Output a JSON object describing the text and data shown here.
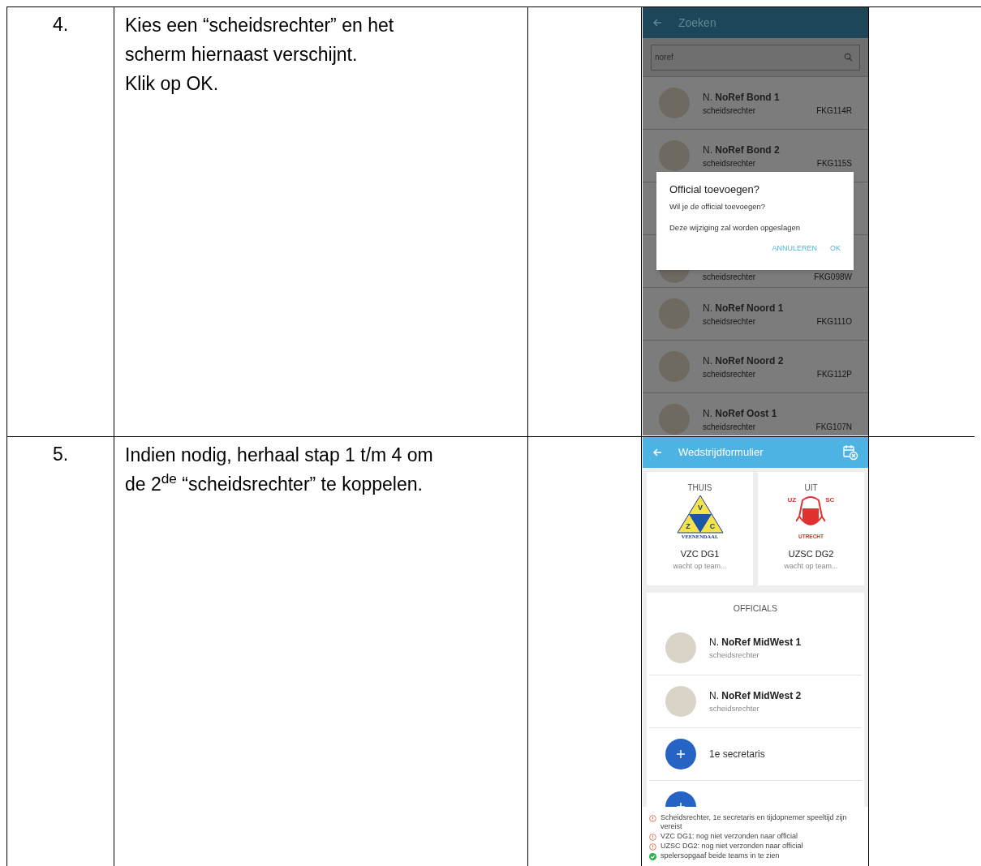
{
  "steps": [
    {
      "number": "4.",
      "lines": [
        "Kies een “scheidsrechter” en het",
        "scherm hiernaast verschijnt.",
        "Klik op OK."
      ],
      "phone": {
        "kind": "search",
        "title": "Zoeken",
        "search_value": "noref",
        "results": [
          {
            "initial": "N.",
            "name": "NoRef Bond 1",
            "role": "scheidsrechter",
            "code": "FKG114R"
          },
          {
            "initial": "N.",
            "name": "NoRef Bond 2",
            "role": "scheidsrechter",
            "code": "FKG115S"
          },
          {
            "role": "scheidsrechter",
            "code": "FKG098W"
          },
          {
            "initial": "N.",
            "name": "NoRef Noord 1",
            "role": "scheidsrechter",
            "code": "FKG111O"
          },
          {
            "initial": "N.",
            "name": "NoRef Noord 2",
            "role": "scheidsrechter",
            "code": "FKG112P"
          },
          {
            "initial": "N.",
            "name": "NoRef Oost 1",
            "role": "scheidsrechter",
            "code": "FKG107N"
          }
        ],
        "dialog": {
          "title": "Official toevoegen?",
          "message": "Wil je de official toevoegen?",
          "note": "Deze wijziging zal worden opgeslagen",
          "buttons": [
            "ANNULEREN",
            "OK"
          ]
        }
      }
    },
    {
      "number": "5.",
      "lines": [
        "Indien nodig, herhaal stap 1 t/m 4 om",
        "de 2$^{de}$ “scheidsrechter” te koppelen."
      ],
      "phone": {
        "kind": "form",
        "title": "Wedstrijdformulier",
        "teams": [
          {
            "label": "THUIS",
            "logo_letters": [
              "V",
              "Z",
              "C"
            ],
            "logo_caption": "VEENENDAAL",
            "name": "VZC DG1",
            "status": "wacht op team..."
          },
          {
            "label": "UIT",
            "logo_letters": [
              "UZ",
              "SC"
            ],
            "logo_caption": "UTRECHT",
            "name": "UZSC DG2",
            "status": "wacht op team..."
          }
        ],
        "officials_title": "OFFICIALS",
        "officials": [
          {
            "kind": "person",
            "initial": "N.",
            "name": "NoRef MidWest 1",
            "role": "scheidsrechter"
          },
          {
            "kind": "person",
            "initial": "N.",
            "name": "NoRef MidWest 2",
            "role": "scheidsrechter"
          },
          {
            "kind": "add",
            "label": "1e secretaris"
          },
          {
            "kind": "add"
          }
        ],
        "notices": [
          {
            "kind": "warning",
            "text": "Scheidsrechter, 1e secretaris en tijdopnemer speeltijd zijn vereist"
          },
          {
            "kind": "warning",
            "text": "VZC DG1: nog niet verzonden naar official"
          },
          {
            "kind": "warning",
            "text": "UZSC DG2: nog niet verzonden naar official"
          },
          {
            "kind": "ok",
            "text": "spelersopgaaf beide teams in te zien"
          }
        ]
      }
    }
  ]
}
